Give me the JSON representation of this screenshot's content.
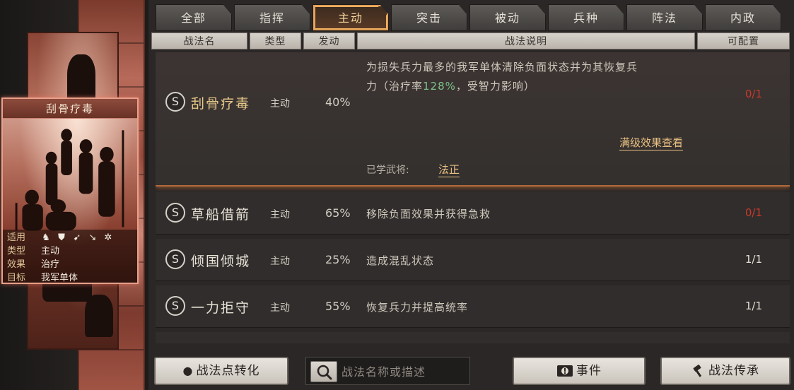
{
  "tabs": [
    "全部",
    "指挥",
    "主动",
    "突击",
    "被动",
    "兵种",
    "阵法",
    "内政"
  ],
  "active_tab": 2,
  "columns": {
    "name": "战法名",
    "type": "类型",
    "trigger": "发动",
    "desc": "战法说明",
    "config": "可配置"
  },
  "feature_card": {
    "title": "刮骨疗毒",
    "labels": {
      "applies": "适用",
      "type": "类型",
      "effect": "效果",
      "target": "目标"
    },
    "values": {
      "type": "主动",
      "effect": "治疗",
      "target": "我军单体"
    },
    "unit_icons": [
      "cavalry-icon",
      "shield-icon",
      "bow-icon",
      "spear-icon",
      "wheel-icon"
    ]
  },
  "expanded": {
    "badge": "S",
    "name": "刮骨疗毒",
    "type": "主动",
    "rate": "40%",
    "desc_line1": "为损失兵力最多的我军单体清除负面状态并为其恢复兵",
    "desc_line2_pre": "力（治疗率",
    "desc_line2_value": "128%",
    "desc_line2_post": "，受智力影响）",
    "cap": "0/1",
    "max_effect_link": "满级效果查看",
    "learned_label": "已学武将:",
    "learned_general": "法正"
  },
  "rows": [
    {
      "badge": "S",
      "name": "草船借箭",
      "type": "主动",
      "rate": "65%",
      "desc": "移除负面效果并获得急救",
      "cap": "0/1"
    },
    {
      "badge": "S",
      "name": "倾国倾城",
      "type": "主动",
      "rate": "25%",
      "desc": "造成混乱状态",
      "cap": "1/1"
    },
    {
      "badge": "S",
      "name": "一力拒守",
      "type": "主动",
      "rate": "55%",
      "desc": "恢复兵力并提高统率",
      "cap": "1/1"
    }
  ],
  "bottom": {
    "convert_label": "战法点转化",
    "search_placeholder": "战法名称或描述",
    "events_label": "事件",
    "inherit_label": "战法传承"
  },
  "colors": {
    "active_tab_border": "#e3a055",
    "cap_red": "#c83a2c",
    "heal_green": "#7cc38b",
    "link_gold": "#e9c082"
  }
}
